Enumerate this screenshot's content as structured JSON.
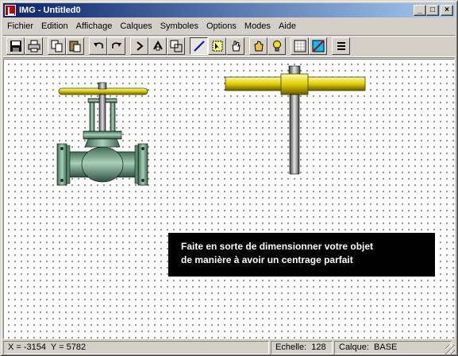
{
  "window": {
    "title": "IMG - Untitled0"
  },
  "title_buttons": {
    "minimize": "_",
    "maximize": "□",
    "close": "×"
  },
  "menu": [
    "Fichier",
    "Edition",
    "Affichage",
    "Calques",
    "Symboles",
    "Options",
    "Modes",
    "Aide"
  ],
  "toolbar": {
    "tools": [
      {
        "name": "save-icon"
      },
      {
        "name": "print-icon"
      },
      {
        "name": "copy-icon"
      },
      {
        "name": "paste-icon"
      },
      {
        "name": "undo-icon"
      },
      {
        "name": "redo-icon"
      },
      {
        "name": "rotate-left-icon"
      },
      {
        "name": "rotate-right-icon"
      },
      {
        "name": "resize-icon"
      },
      {
        "name": "line-tool-icon",
        "pressed": true
      },
      {
        "name": "select-tool-icon"
      },
      {
        "name": "hand-tool-icon"
      },
      {
        "name": "grab-icon"
      },
      {
        "name": "bulb-icon"
      },
      {
        "name": "grid-icon"
      },
      {
        "name": "color-icon"
      },
      {
        "name": "menu-lines-icon"
      }
    ]
  },
  "canvas": {
    "message": {
      "line1": "Faite en sorte de dimensionner votre objet",
      "line2": "de manière à avoir un centrage parfait"
    },
    "objects": [
      "gate-valve-symbol",
      "handwheel-stem-symbol"
    ]
  },
  "status": {
    "coords": "X = -3154  Y = 5782",
    "scale": "Echelle:  128",
    "layer": "Calque:  BASE"
  },
  "colors": {
    "titlebar_start": "#0a246a",
    "titlebar_end": "#a6caf0",
    "valve_body": "#6b9a80",
    "handwheel": "#e0d000"
  }
}
